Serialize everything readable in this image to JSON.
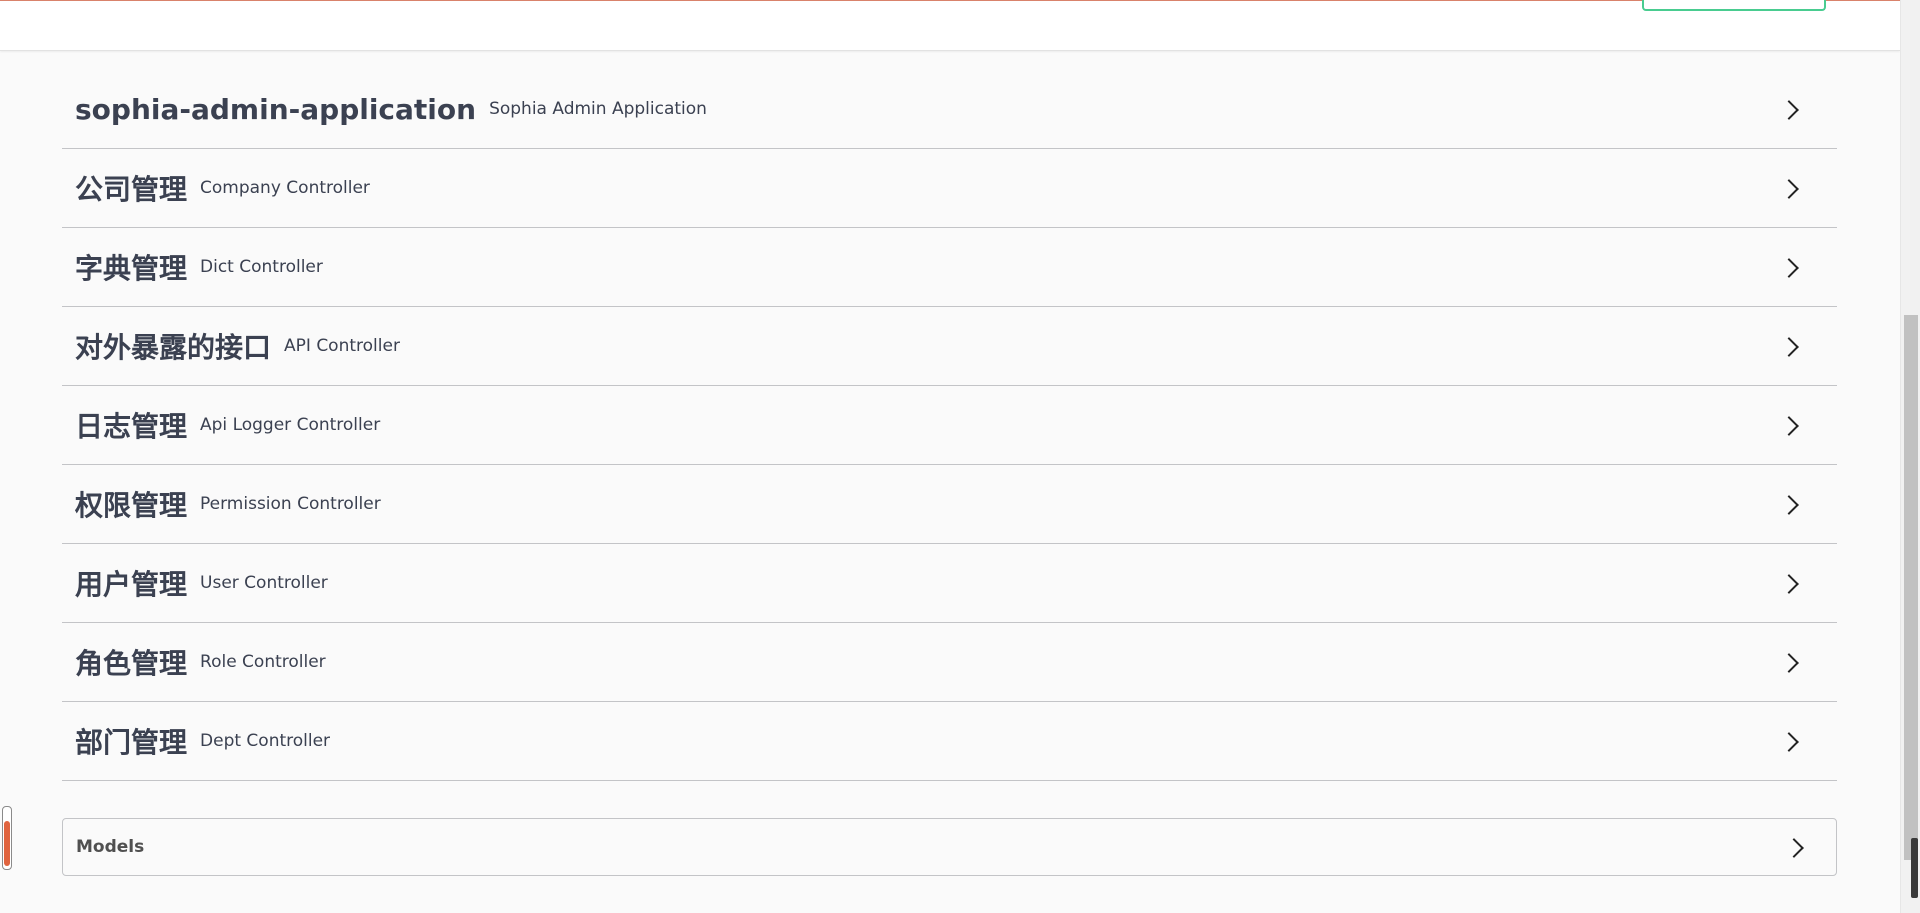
{
  "sections": [
    {
      "name": "sophia-admin-application",
      "description": "Sophia Admin Application"
    },
    {
      "name": "公司管理",
      "description": "Company Controller"
    },
    {
      "name": "字典管理",
      "description": "Dict Controller"
    },
    {
      "name": "对外暴露的接口",
      "description": "API Controller"
    },
    {
      "name": "日志管理",
      "description": "Api Logger Controller"
    },
    {
      "name": "权限管理",
      "description": "Permission Controller"
    },
    {
      "name": "用户管理",
      "description": "User Controller"
    },
    {
      "name": "角色管理",
      "description": "Role Controller"
    },
    {
      "name": "部门管理",
      "description": "Dept Controller"
    }
  ],
  "models": {
    "label": "Models"
  },
  "icons": {
    "expand": "chevron-right-icon"
  },
  "colors": {
    "accent_green": "#49cc90",
    "text": "#3b4151",
    "border": "#c3c4c7",
    "background": "#fafafa",
    "widget_orange": "#e0643f"
  }
}
